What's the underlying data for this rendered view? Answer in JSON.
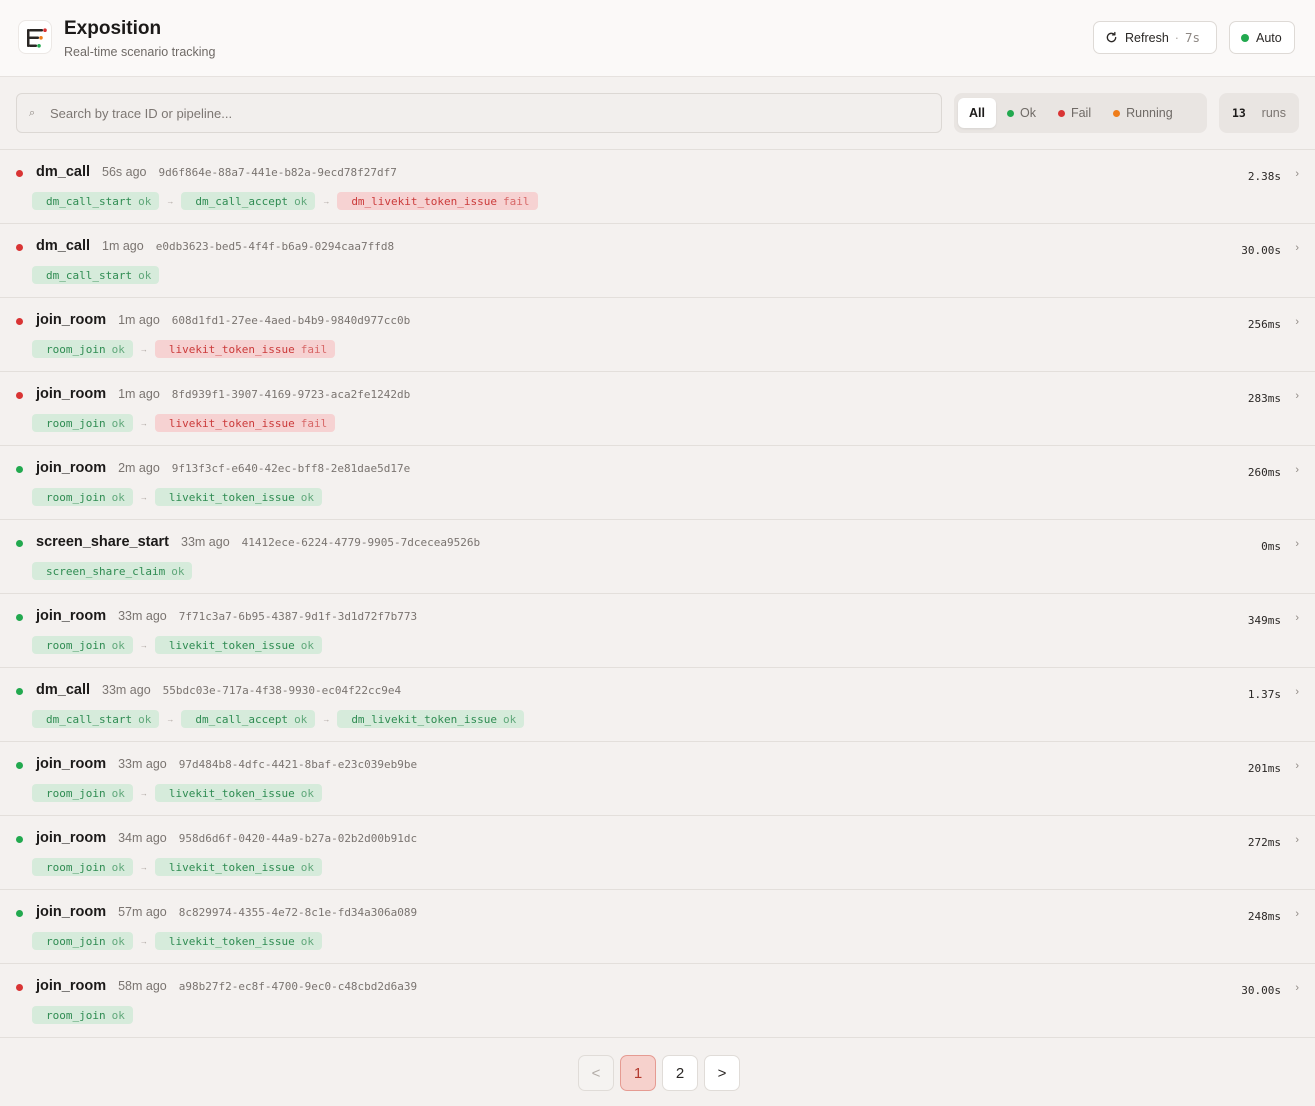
{
  "header": {
    "title": "Exposition",
    "subtitle": "Real-time scenario tracking",
    "refresh_label": "Refresh",
    "refresh_countdown": "7s",
    "auto_label": "Auto"
  },
  "search": {
    "placeholder": "Search by trace ID or pipeline..."
  },
  "filters": [
    {
      "label": "All",
      "active": true
    },
    {
      "label": "Ok",
      "dot": "#22a94f"
    },
    {
      "label": "Fail",
      "dot": "#d93434"
    },
    {
      "label": "Running",
      "dot": "#ef7d1a"
    }
  ],
  "runs": {
    "count": "13",
    "label": "runs"
  },
  "rows": [
    {
      "status": "fail",
      "pipeline": "dm_call",
      "ago": "56s ago",
      "trace": "9d6f864e-88a7-441e-b82a-9ecd78f27df7",
      "duration": "2.38s",
      "steps": [
        {
          "name": "dm_call_start",
          "status": "ok"
        },
        {
          "name": "dm_call_accept",
          "status": "ok"
        },
        {
          "name": "dm_livekit_token_issue",
          "status": "fail"
        }
      ]
    },
    {
      "status": "fail",
      "pipeline": "dm_call",
      "ago": "1m ago",
      "trace": "e0db3623-bed5-4f4f-b6a9-0294caa7ffd8",
      "duration": "30.00s",
      "steps": [
        {
          "name": "dm_call_start",
          "status": "ok"
        }
      ]
    },
    {
      "status": "fail",
      "pipeline": "join_room",
      "ago": "1m ago",
      "trace": "608d1fd1-27ee-4aed-b4b9-9840d977cc0b",
      "duration": "256ms",
      "steps": [
        {
          "name": "room_join",
          "status": "ok"
        },
        {
          "name": "livekit_token_issue",
          "status": "fail"
        }
      ]
    },
    {
      "status": "fail",
      "pipeline": "join_room",
      "ago": "1m ago",
      "trace": "8fd939f1-3907-4169-9723-aca2fe1242db",
      "duration": "283ms",
      "steps": [
        {
          "name": "room_join",
          "status": "ok"
        },
        {
          "name": "livekit_token_issue",
          "status": "fail"
        }
      ]
    },
    {
      "status": "ok",
      "pipeline": "join_room",
      "ago": "2m ago",
      "trace": "9f13f3cf-e640-42ec-bff8-2e81dae5d17e",
      "duration": "260ms",
      "steps": [
        {
          "name": "room_join",
          "status": "ok"
        },
        {
          "name": "livekit_token_issue",
          "status": "ok"
        }
      ]
    },
    {
      "status": "ok",
      "pipeline": "screen_share_start",
      "ago": "33m ago",
      "trace": "41412ece-6224-4779-9905-7dcecea9526b",
      "duration": "0ms",
      "steps": [
        {
          "name": "screen_share_claim",
          "status": "ok"
        }
      ]
    },
    {
      "status": "ok",
      "pipeline": "join_room",
      "ago": "33m ago",
      "trace": "7f71c3a7-6b95-4387-9d1f-3d1d72f7b773",
      "duration": "349ms",
      "steps": [
        {
          "name": "room_join",
          "status": "ok"
        },
        {
          "name": "livekit_token_issue",
          "status": "ok"
        }
      ]
    },
    {
      "status": "ok",
      "pipeline": "dm_call",
      "ago": "33m ago",
      "trace": "55bdc03e-717a-4f38-9930-ec04f22cc9e4",
      "duration": "1.37s",
      "steps": [
        {
          "name": "dm_call_start",
          "status": "ok"
        },
        {
          "name": "dm_call_accept",
          "status": "ok"
        },
        {
          "name": "dm_livekit_token_issue",
          "status": "ok"
        }
      ]
    },
    {
      "status": "ok",
      "pipeline": "join_room",
      "ago": "33m ago",
      "trace": "97d484b8-4dfc-4421-8baf-e23c039eb9be",
      "duration": "201ms",
      "steps": [
        {
          "name": "room_join",
          "status": "ok"
        },
        {
          "name": "livekit_token_issue",
          "status": "ok"
        }
      ]
    },
    {
      "status": "ok",
      "pipeline": "join_room",
      "ago": "34m ago",
      "trace": "958d6d6f-0420-44a9-b27a-02b2d00b91dc",
      "duration": "272ms",
      "steps": [
        {
          "name": "room_join",
          "status": "ok"
        },
        {
          "name": "livekit_token_issue",
          "status": "ok"
        }
      ]
    },
    {
      "status": "ok",
      "pipeline": "join_room",
      "ago": "57m ago",
      "trace": "8c829974-4355-4e72-8c1e-fd34a306a089",
      "duration": "248ms",
      "steps": [
        {
          "name": "room_join",
          "status": "ok"
        },
        {
          "name": "livekit_token_issue",
          "status": "ok"
        }
      ]
    },
    {
      "status": "fail",
      "pipeline": "join_room",
      "ago": "58m ago",
      "trace": "a98b27f2-ec8f-4700-9ec0-c48cbd2d6a39",
      "duration": "30.00s",
      "steps": [
        {
          "name": "room_join",
          "status": "ok"
        }
      ]
    }
  ],
  "pagination": {
    "prev": "<",
    "pages": [
      "1",
      "2"
    ],
    "current": "1",
    "next": ">"
  },
  "colors": {
    "ok": "#22a94f",
    "fail": "#d93434",
    "running": "#ef7d1a",
    "accent": "#f6d1cc"
  },
  "icons": {
    "logo": "timeline-logo-icon",
    "refresh": "refresh-icon",
    "search": "search-icon",
    "chevron": "chevron-right-icon"
  }
}
